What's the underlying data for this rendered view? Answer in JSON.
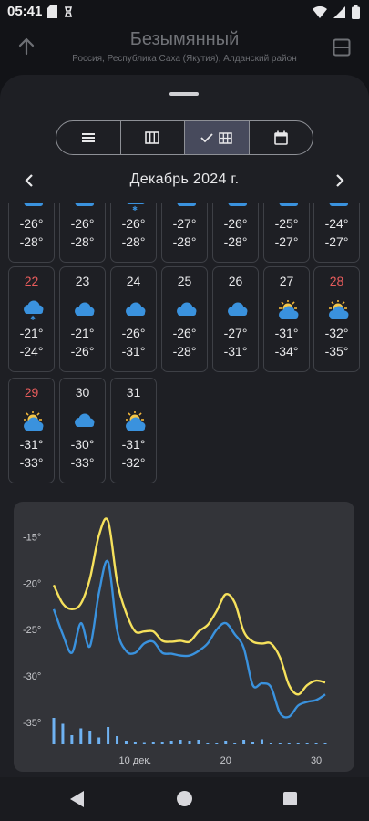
{
  "status": {
    "time": "05:41",
    "icons": [
      "sd-card-icon",
      "sync-icon",
      "wifi-icon",
      "signal-icon",
      "battery-icon"
    ]
  },
  "header": {
    "title": "Безымянный",
    "subtitle": "Россия, Республика Саха (Якутия), Алданский район",
    "left_icon": "arrow-up-icon",
    "right_icon": "layout-icon"
  },
  "view_toggle": {
    "options": [
      "list-view",
      "columns-view",
      "grid-view",
      "calendar-view"
    ],
    "selected": "grid-view"
  },
  "month": {
    "title": "Декабрь 2024 г."
  },
  "calendar": {
    "partial_row": [
      {
        "icon": "cloud-icon",
        "max": "-26°",
        "min": "-28°"
      },
      {
        "icon": "cloud-icon",
        "max": "-26°",
        "min": "-28°"
      },
      {
        "icon": "snow-cloud-icon",
        "max": "-26°",
        "min": "-28°"
      },
      {
        "icon": "cloud-icon",
        "max": "-27°",
        "min": "-28°"
      },
      {
        "icon": "cloud-icon",
        "max": "-26°",
        "min": "-28°"
      },
      {
        "icon": "cloud-icon",
        "max": "-25°",
        "min": "-27°"
      },
      {
        "icon": "cloud-icon",
        "max": "-24°",
        "min": "-27°"
      }
    ],
    "days": [
      {
        "day": "22",
        "weekend": true,
        "icon": "snow-cloud-icon",
        "max": "-21°",
        "min": "-24°"
      },
      {
        "day": "23",
        "weekend": false,
        "icon": "cloud-icon",
        "max": "-21°",
        "min": "-26°"
      },
      {
        "day": "24",
        "weekend": false,
        "icon": "cloud-icon",
        "max": "-26°",
        "min": "-31°"
      },
      {
        "day": "25",
        "weekend": false,
        "icon": "cloud-icon",
        "max": "-26°",
        "min": "-28°"
      },
      {
        "day": "26",
        "weekend": false,
        "icon": "cloud-icon",
        "max": "-27°",
        "min": "-31°"
      },
      {
        "day": "27",
        "weekend": false,
        "icon": "sun-cloud-icon",
        "max": "-31°",
        "min": "-34°"
      },
      {
        "day": "28",
        "weekend": true,
        "icon": "sun-cloud-icon",
        "max": "-32°",
        "min": "-35°"
      },
      {
        "day": "29",
        "weekend": true,
        "icon": "sun-cloud-icon",
        "max": "-31°",
        "min": "-33°"
      },
      {
        "day": "30",
        "weekend": false,
        "icon": "cloud-icon",
        "max": "-30°",
        "min": "-33°"
      },
      {
        "day": "31",
        "weekend": false,
        "icon": "sun-cloud-icon",
        "max": "-31°",
        "min": "-32°"
      }
    ]
  },
  "chart_data": {
    "type": "line",
    "x": [
      1,
      2,
      3,
      4,
      5,
      6,
      7,
      8,
      9,
      10,
      11,
      12,
      13,
      14,
      15,
      16,
      17,
      18,
      19,
      20,
      21,
      22,
      23,
      24,
      25,
      26,
      27,
      28,
      29,
      30,
      31
    ],
    "ylim": [
      -36,
      -12
    ],
    "yticks": [
      -15,
      -20,
      -25,
      -30,
      -35
    ],
    "ytick_labels": [
      "-15°",
      "-20°",
      "-25°",
      "-30°",
      "-35°"
    ],
    "xtick_labels": [
      {
        "x": 10,
        "label": "10 дек."
      },
      {
        "x": 20,
        "label": "20"
      },
      {
        "x": 30,
        "label": "30"
      }
    ],
    "series": [
      {
        "color": "#f6e15c",
        "values": [
          -20.2,
          -22.2,
          -22.8,
          -22.2,
          -19.5,
          -14.8,
          -13.3,
          -19.8,
          -23.2,
          -25.2,
          -25.2,
          -25.2,
          -26.2,
          -26.3,
          -26.2,
          -26.3,
          -25.2,
          -24.5,
          -23.0,
          -21.2,
          -22.1,
          -25.2,
          -26.3,
          -26.5,
          -26.5,
          -28.0,
          -31.0,
          -32.0,
          -31.0,
          -30.5,
          -30.7
        ]
      },
      {
        "color": "#3a92de",
        "values": [
          -22.8,
          -25.5,
          -27.5,
          -24.3,
          -26.8,
          -21.0,
          -17.7,
          -25.0,
          -27.3,
          -27.5,
          -26.5,
          -26.3,
          -27.5,
          -27.6,
          -27.8,
          -27.8,
          -27.3,
          -26.5,
          -25.0,
          -24.3,
          -25.5,
          -27.0,
          -31.0,
          -30.8,
          -31.2,
          -34.0,
          -34.4,
          -33.2,
          -32.8,
          -32.6,
          -32.0
        ]
      }
    ],
    "bars": {
      "color": "#6fb2f2",
      "values": [
        5.8,
        4.5,
        2.0,
        3.5,
        3.0,
        1.5,
        3.8,
        1.8,
        0.8,
        0.6,
        0.5,
        0.6,
        0.6,
        0.8,
        1.0,
        0.8,
        1.0,
        0.3,
        0.4,
        0.8,
        0.3,
        1.0,
        0.6,
        1.1,
        0.3,
        0.3,
        0.3,
        0.3,
        0.3,
        0.3,
        0.3
      ]
    }
  }
}
